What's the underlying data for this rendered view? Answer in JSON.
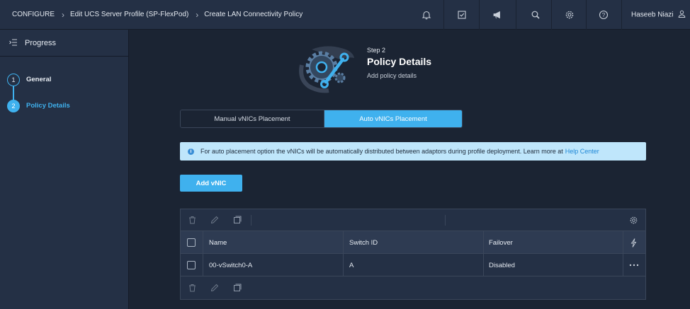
{
  "breadcrumb": {
    "items": [
      "CONFIGURE",
      "Edit UCS Server Profile (SP-FlexPod)",
      "Create LAN Connectivity Policy"
    ]
  },
  "topbar": {
    "icons": [
      "bell-icon",
      "checklist-icon",
      "megaphone-icon",
      "search-icon",
      "gear-icon",
      "help-icon"
    ],
    "user_name": "Haseeb Niazi"
  },
  "sidebar": {
    "title": "Progress",
    "steps": [
      {
        "num": "1",
        "label": "General",
        "active": false
      },
      {
        "num": "2",
        "label": "Policy Details",
        "active": true
      }
    ]
  },
  "header": {
    "step": "Step 2",
    "title": "Policy Details",
    "subtitle": "Add policy details"
  },
  "placement": {
    "options": [
      "Manual vNICs Placement",
      "Auto vNICs Placement"
    ],
    "selected": "Auto vNICs Placement"
  },
  "banner": {
    "text": "For auto placement option the vNICs will be automatically distributed between adaptors during profile deployment. Learn more at",
    "link": "Help Center"
  },
  "add_button": "Add vNIC",
  "table": {
    "columns": [
      "Name",
      "Switch ID",
      "Failover"
    ],
    "rows": [
      {
        "name": "00-vSwitch0-A",
        "switch_id": "A",
        "failover": "Disabled"
      }
    ]
  },
  "colors": {
    "accent": "#3fb1ee",
    "background": "#1b2433",
    "panel": "#243045",
    "banner": "#bfe6fb"
  }
}
